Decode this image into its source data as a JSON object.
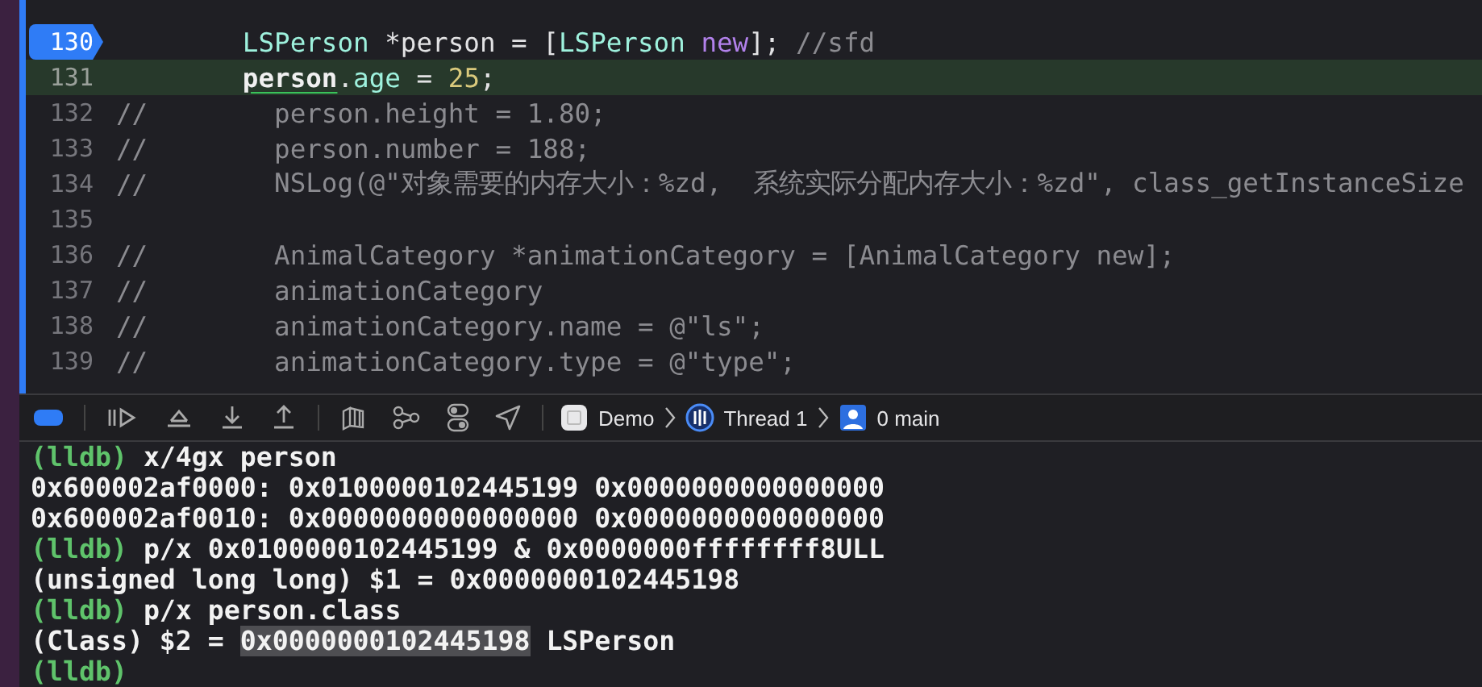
{
  "editor": {
    "lines": [
      {
        "number": "130",
        "breakpoint": true,
        "current": false,
        "tokens": [
          {
            "text": "LSPerson",
            "kind": "type"
          },
          {
            "text": " *person = [",
            "kind": "plain"
          },
          {
            "text": "LSPerson",
            "kind": "type"
          },
          {
            "text": " new",
            "kind": "keyword"
          },
          {
            "text": "]; ",
            "kind": "plain"
          },
          {
            "text": "//sfd",
            "kind": "comment"
          }
        ]
      },
      {
        "number": "131",
        "breakpoint": false,
        "current": true,
        "tokens": [
          {
            "text": "person",
            "kind": "flagged"
          },
          {
            "text": ".",
            "kind": "plain"
          },
          {
            "text": "age",
            "kind": "type"
          },
          {
            "text": " = ",
            "kind": "plain"
          },
          {
            "text": "25",
            "kind": "number"
          },
          {
            "text": ";",
            "kind": "plain"
          }
        ]
      },
      {
        "number": "132",
        "marker": "//",
        "breakpoint": false,
        "current": false,
        "tokens": [
          {
            "text": "  person.height = 1.80;",
            "kind": "comment"
          }
        ]
      },
      {
        "number": "133",
        "marker": "//",
        "breakpoint": false,
        "current": false,
        "tokens": [
          {
            "text": "  person.number = 188;",
            "kind": "comment"
          }
        ]
      },
      {
        "number": "134",
        "marker": "//",
        "breakpoint": false,
        "current": false,
        "tokens": [
          {
            "text": "  NSLog(@\"对象需要的内存大小：%zd,  系统实际分配内存大小：%zd\", class_getInstanceSize",
            "kind": "comment"
          }
        ]
      },
      {
        "number": "135",
        "breakpoint": false,
        "current": false
      },
      {
        "number": "136",
        "marker": "//",
        "breakpoint": false,
        "current": false,
        "tokens": [
          {
            "text": "  AnimalCategory *animationCategory = [AnimalCategory new];",
            "kind": "comment"
          }
        ]
      },
      {
        "number": "137",
        "marker": "//",
        "breakpoint": false,
        "current": false,
        "tokens": [
          {
            "text": "  animationCategory",
            "kind": "comment"
          }
        ]
      },
      {
        "number": "138",
        "marker": "//",
        "breakpoint": false,
        "current": false,
        "tokens": [
          {
            "text": "  animationCategory.name = @\"ls\";",
            "kind": "comment"
          }
        ]
      },
      {
        "number": "139",
        "marker": "//",
        "breakpoint": false,
        "current": false,
        "tokens": [
          {
            "text": "  animationCategory.type = @\"type\";",
            "kind": "comment"
          }
        ]
      }
    ]
  },
  "debug_bar": {
    "breakpoints_active": true,
    "path": [
      {
        "label": "Demo",
        "kind": "app"
      },
      {
        "label": "Thread 1",
        "kind": "thread"
      },
      {
        "label": "0 main",
        "kind": "frame"
      }
    ]
  },
  "console": {
    "lines": [
      [
        {
          "text": "(lldb)",
          "kind": "prompt"
        },
        {
          "text": " x/4gx person",
          "kind": "command"
        }
      ],
      [
        {
          "text": "0x600002af0000: 0x0100000102445199 0x0000000000000000",
          "kind": "output"
        }
      ],
      [
        {
          "text": "0x600002af0010: 0x0000000000000000 0x0000000000000000",
          "kind": "output"
        }
      ],
      [
        {
          "text": "(lldb)",
          "kind": "prompt"
        },
        {
          "text": " p/x 0x0100000102445199 & 0x0000000ffffffff8ULL",
          "kind": "command"
        }
      ],
      [
        {
          "text": "(unsigned long long) $1 = 0x0000000102445198",
          "kind": "output"
        }
      ],
      [
        {
          "text": "(lldb)",
          "kind": "prompt"
        },
        {
          "text": " p/x person.class",
          "kind": "command"
        }
      ],
      [
        {
          "text": "(Class) $2 = ",
          "kind": "output"
        },
        {
          "text": "0x0000000102445198",
          "kind": "selection"
        },
        {
          "text": " LSPerson",
          "kind": "output"
        }
      ],
      [
        {
          "text": "(lldb)",
          "kind": "prompt"
        }
      ]
    ]
  }
}
